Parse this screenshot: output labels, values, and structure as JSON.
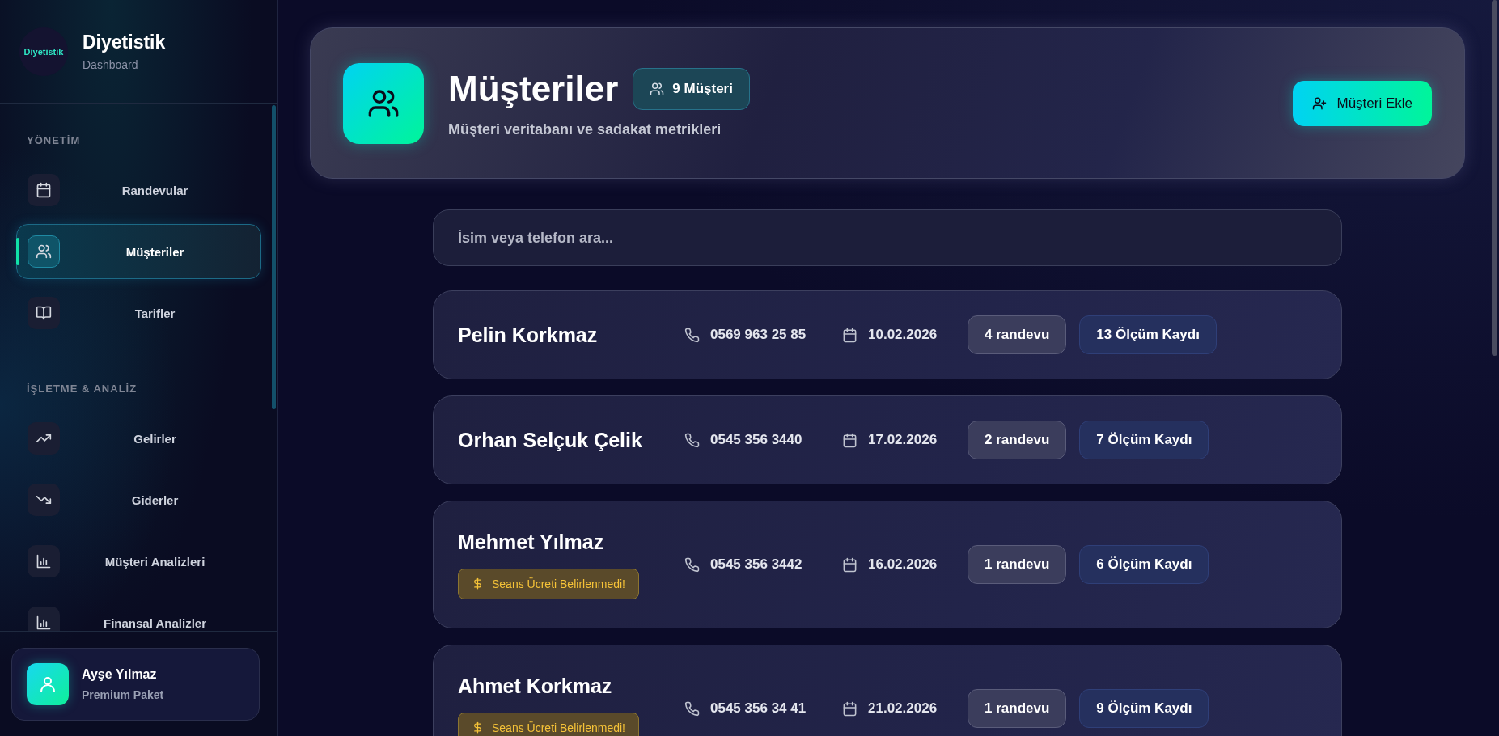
{
  "sidebar": {
    "logo": "Diyetistik",
    "title": "Diyetistik",
    "subtitle": "Dashboard",
    "sections": [
      {
        "heading": "YÖNETİM",
        "items": [
          {
            "label": "Randevular",
            "selected": false
          },
          {
            "label": "Müşteriler",
            "selected": true
          },
          {
            "label": "Tarifler",
            "selected": false
          }
        ]
      },
      {
        "heading": "İŞLETME & ANALİZ",
        "items": [
          {
            "label": "Gelirler",
            "selected": false
          },
          {
            "label": "Giderler",
            "selected": false
          },
          {
            "label": "Müşteri Analizleri",
            "selected": false
          },
          {
            "label": "Finansal Analizler",
            "selected": false
          }
        ]
      }
    ],
    "user": {
      "name": "Ayşe Yılmaz",
      "plan": "Premium Paket"
    }
  },
  "header": {
    "title": "Müşteriler",
    "count_badge": "9 Müşteri",
    "subtitle": "Müşteri veritabanı ve sadakat metrikleri",
    "add_button": "Müşteri Ekle"
  },
  "search": {
    "placeholder": "İsim veya telefon ara..."
  },
  "clients": [
    {
      "name": "Pelin Korkmaz",
      "phone": "0569 963 25 85",
      "date": "10.02.2026",
      "appointments": "4 randevu",
      "measurements": "13 Ölçüm Kaydı"
    },
    {
      "name": "Orhan Selçuk Çelik",
      "phone": "0545 356 3440",
      "date": "17.02.2026",
      "appointments": "2 randevu",
      "measurements": "7 Ölçüm Kaydı"
    },
    {
      "name": "Mehmet Yılmaz",
      "warning": "Seans Ücreti Belirlenmedi!",
      "phone": "0545 356 3442",
      "date": "16.02.2026",
      "appointments": "1 randevu",
      "measurements": "6 Ölçüm Kaydı"
    },
    {
      "name": "Ahmet Korkmaz",
      "warning": "Seans Ücreti Belirlenmedi!",
      "phone": "0545 356 34 41",
      "date": "21.02.2026",
      "appointments": "1 randevu",
      "measurements": "9 Ölçüm Kaydı"
    }
  ]
}
